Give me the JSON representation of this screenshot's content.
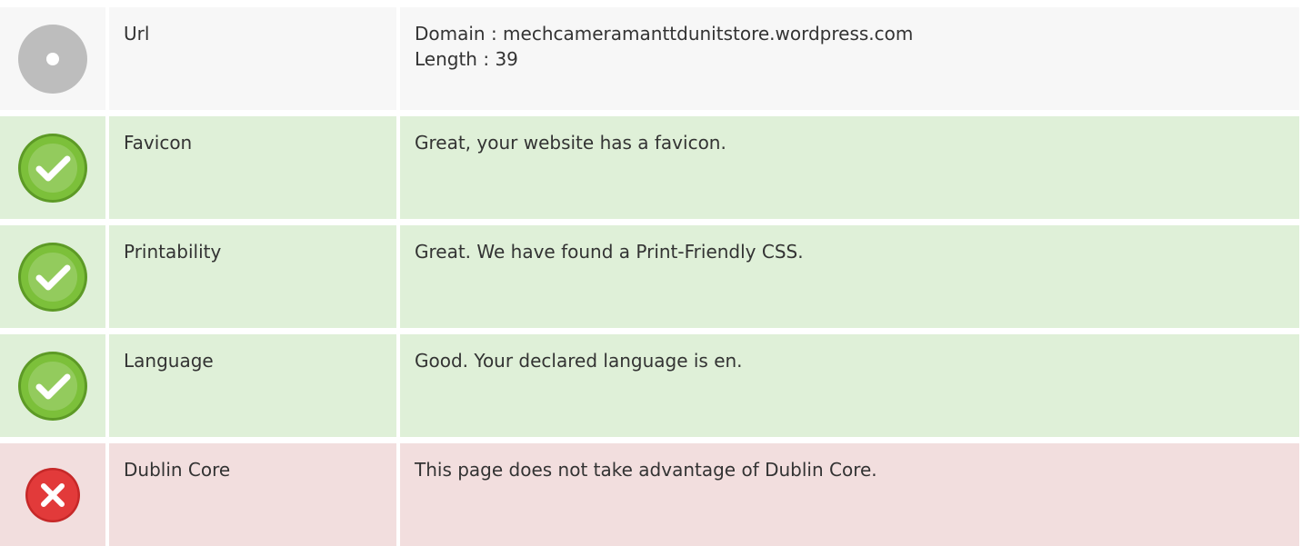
{
  "rows": [
    {
      "status": "info",
      "icon": "info-circle-icon",
      "label": "Url",
      "lines": [
        "Domain : mechcameramanttdunitstore.wordpress.com",
        "Length : 39"
      ]
    },
    {
      "status": "pass",
      "icon": "check-circle-icon",
      "label": "Favicon",
      "lines": [
        "Great, your website has a favicon."
      ]
    },
    {
      "status": "pass",
      "icon": "check-circle-icon",
      "label": "Printability",
      "lines": [
        "Great. We have found a Print-Friendly CSS."
      ]
    },
    {
      "status": "pass",
      "icon": "check-circle-icon",
      "label": "Language",
      "lines": [
        "Good. Your declared language is en."
      ]
    },
    {
      "status": "fail",
      "icon": "error-circle-icon",
      "label": "Dublin Core",
      "lines": [
        "This page does not take advantage of Dublin Core."
      ]
    }
  ],
  "colors": {
    "info_bg": "#f7f7f7",
    "pass_bg": "#dff0d8",
    "fail_bg": "#f2dede",
    "pass_icon": "#7cc03a",
    "fail_icon": "#e23a3a",
    "info_icon": "#bdbdbd"
  }
}
